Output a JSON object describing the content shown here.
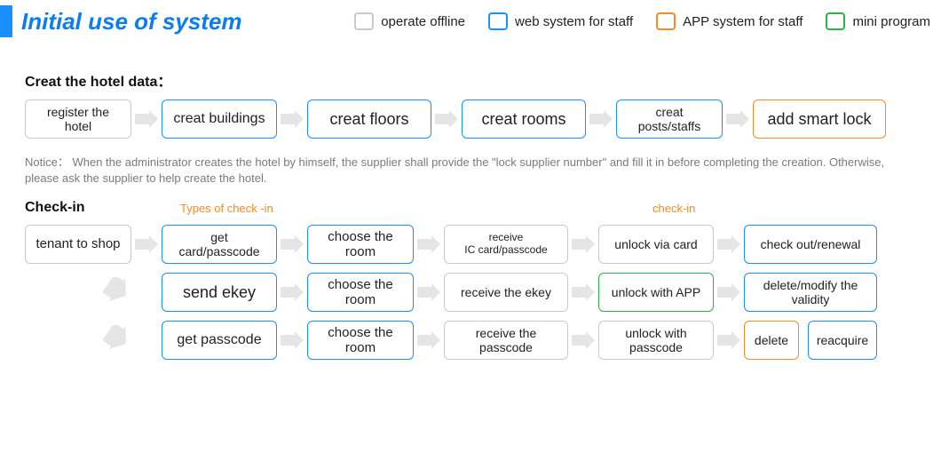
{
  "title": "Initial use of system",
  "legend": {
    "offline": "operate offline",
    "web": "web system for staff",
    "app": "APP system for staff",
    "mini": "mini program"
  },
  "section1": {
    "title": "Creat the hotel data：",
    "steps": {
      "register": "register the hotel",
      "buildings": "creat buildings",
      "floors": "creat floors",
      "rooms": "creat rooms",
      "posts": "creat posts/staffs",
      "lock": "add smart lock"
    },
    "notice": "Notice： When the administrator creates the hotel by himself, the supplier shall provide the \"lock supplier number\" and fill it in before completing the creation. Otherwise, please ask the supplier to help create the hotel."
  },
  "section2": {
    "title": "Check-in",
    "labels": {
      "types": "Types of check -in",
      "checkin": "check-in"
    },
    "tenant": "tenant to shop",
    "rowA": {
      "get": "get card/passcode",
      "choose": "choose the room",
      "receive": "receive\nIC card/passcode",
      "unlock": "unlock via card",
      "out": "check out/renewal"
    },
    "rowB": {
      "send": "send ekey",
      "choose": "choose the room",
      "receive": "receive the ekey",
      "unlock": "unlock with APP",
      "out": "delete/modify the validity"
    },
    "rowC": {
      "get": "get passcode",
      "choose": "choose the room",
      "receive": "receive the passcode",
      "unlock": "unlock with passcode",
      "del": "delete",
      "reacq": "reacquire"
    }
  }
}
